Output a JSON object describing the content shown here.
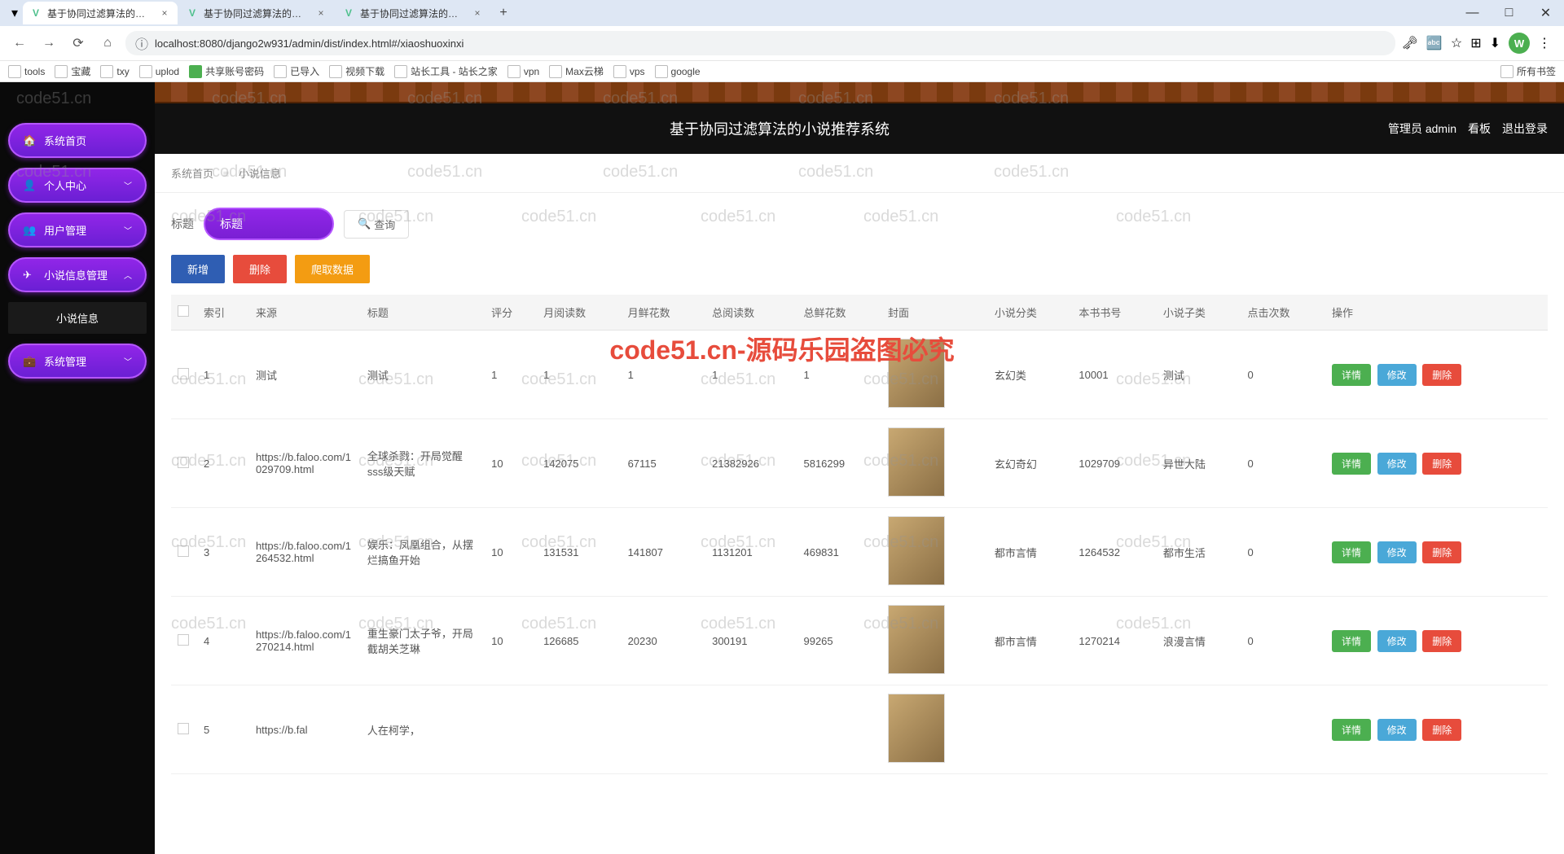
{
  "browser": {
    "tabs": [
      {
        "title": "基于协同过滤算法的小说推荐系"
      },
      {
        "title": "基于协同过滤算法的小说推荐系"
      },
      {
        "title": "基于协同过滤算法的小说推荐系"
      }
    ],
    "url": "localhost:8080/django2w931/admin/dist/index.html#/xiaoshuoxinxi",
    "avatar_letter": "W",
    "bookmarks": [
      "tools",
      "宝藏",
      "txy",
      "uplod",
      "共享账号密码",
      "已导入",
      "视频下载",
      "站长工具 - 站长之家",
      "vpn",
      "Max云梯",
      "vps",
      "google"
    ],
    "bookmarks_right": "所有书签"
  },
  "header": {
    "title": "基于协同过滤算法的小说推荐系统",
    "admin_label": "管理员 admin",
    "board": "看板",
    "logout": "退出登录"
  },
  "sidebar": {
    "items": [
      {
        "icon": "🏠",
        "label": "系统首页"
      },
      {
        "icon": "👤",
        "label": "个人中心"
      },
      {
        "icon": "👥",
        "label": "用户管理"
      },
      {
        "icon": "✈",
        "label": "小说信息管理"
      },
      {
        "icon": "💼",
        "label": "系统管理"
      }
    ],
    "submenu": "小说信息"
  },
  "breadcrumb": {
    "root": "系统首页",
    "current": "小说信息"
  },
  "search": {
    "label": "标题",
    "value": "标题",
    "button": "查询"
  },
  "action_bar": {
    "add": "新增",
    "delete": "删除",
    "crawl": "爬取数据"
  },
  "table": {
    "headers": [
      "索引",
      "来源",
      "标题",
      "评分",
      "月阅读数",
      "月鲜花数",
      "总阅读数",
      "总鲜花数",
      "封面",
      "小说分类",
      "本书书号",
      "小说子类",
      "点击次数",
      "操作"
    ],
    "ops": {
      "detail": "详情",
      "edit": "修改",
      "delete": "删除"
    },
    "rows": [
      {
        "idx": "1",
        "source": "测试",
        "title": "测试",
        "score": "1",
        "m_read": "1",
        "m_flower": "1",
        "t_read": "1",
        "t_flower": "1",
        "cat": "玄幻类",
        "book": "10001",
        "subcat": "测试",
        "clicks": "0"
      },
      {
        "idx": "2",
        "source": "https://b.faloo.com/1029709.html",
        "title": "全球杀戮：开局觉醒sss级天赋",
        "score": "10",
        "m_read": "142075",
        "m_flower": "67115",
        "t_read": "21382926",
        "t_flower": "5816299",
        "cat": "玄幻奇幻",
        "book": "1029709",
        "subcat": "异世大陆",
        "clicks": "0"
      },
      {
        "idx": "3",
        "source": "https://b.faloo.com/1264532.html",
        "title": "娱乐：凤凰组合，从摆烂搞鱼开始",
        "score": "10",
        "m_read": "131531",
        "m_flower": "141807",
        "t_read": "1131201",
        "t_flower": "469831",
        "cat": "都市言情",
        "book": "1264532",
        "subcat": "都市生活",
        "clicks": "0"
      },
      {
        "idx": "4",
        "source": "https://b.faloo.com/1270214.html",
        "title": "重生豪门太子爷，开局截胡关芝琳",
        "score": "10",
        "m_read": "126685",
        "m_flower": "20230",
        "t_read": "300191",
        "t_flower": "99265",
        "cat": "都市言情",
        "book": "1270214",
        "subcat": "浪漫言情",
        "clicks": "0"
      },
      {
        "idx": "5",
        "source": "https://b.fal",
        "title": "人在柯学，",
        "score": "",
        "m_read": "",
        "m_flower": "",
        "t_read": "",
        "t_flower": "",
        "cat": "",
        "book": "",
        "subcat": "",
        "clicks": ""
      }
    ]
  },
  "watermark_text": "code51.cn",
  "big_watermark": "code51.cn-源码乐园盗图必究"
}
